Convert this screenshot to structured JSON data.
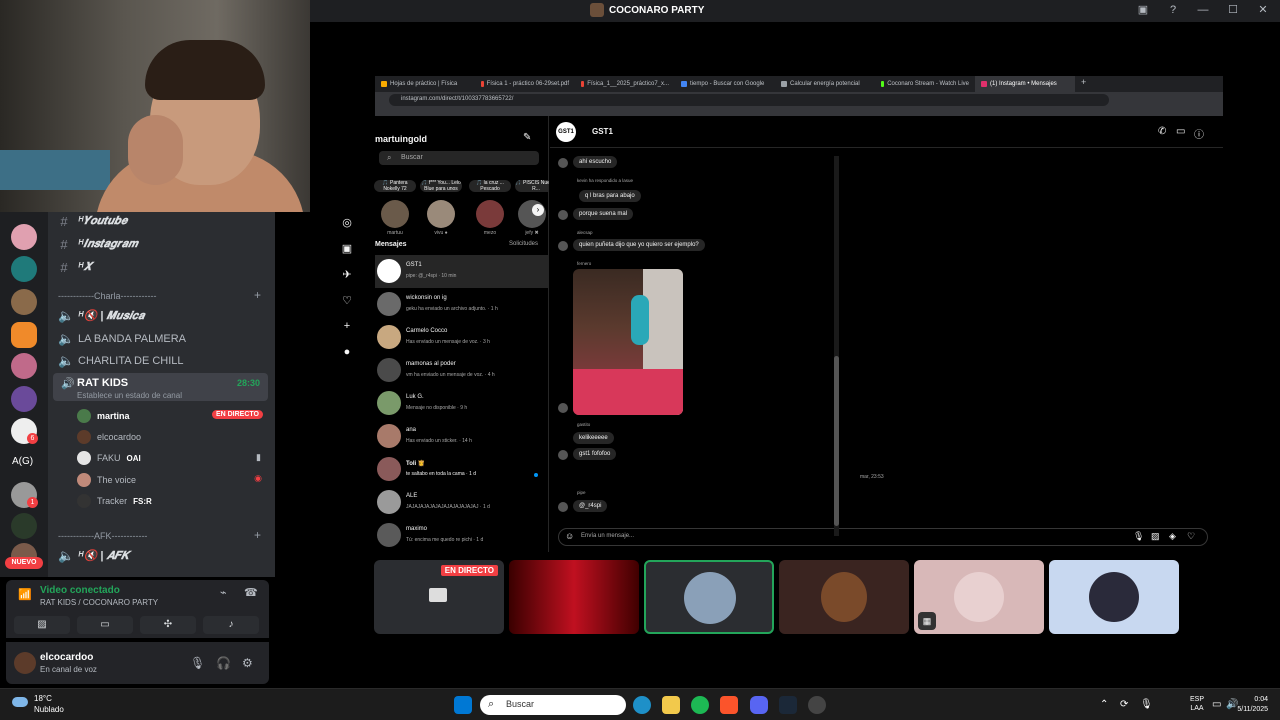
{
  "window": {
    "title": "COCONARO PARTY"
  },
  "channels": {
    "text": [
      {
        "icon": "#",
        "label": "ᴴ𝒀𝒐𝒖𝒕𝒖𝒃𝒆"
      },
      {
        "icon": "#",
        "label": "ᴴ𝑰𝒏𝒔𝒕𝒂𝒈𝒓𝒂𝒎"
      },
      {
        "icon": "#",
        "label": "ᴴ𝑿"
      }
    ],
    "category_charla": "------------Charla------------",
    "voice": [
      {
        "label": "ᴴ🔇 | 𝑴𝒖𝒔𝒊𝒄𝒂"
      },
      {
        "label": "LA BANDA PALMERA"
      },
      {
        "label": "CHARLITA DE CHILL"
      }
    ],
    "active": {
      "label": "RAT KIDS",
      "timer": "28:30",
      "status": "Establece un estado de canal"
    },
    "members": [
      {
        "name": "martina",
        "badge": "EN DIRECTO",
        "color": "#4a7a4a"
      },
      {
        "name": "elcocardoo",
        "badge": "",
        "color": "#5c3b2a"
      },
      {
        "name": "FAKU",
        "badge": "OAI",
        "color": "#e5e5e5"
      },
      {
        "name": "The voice",
        "badge": "",
        "color": "#c08a7a"
      },
      {
        "name": "Tracker",
        "badge": "FS:R",
        "color": "#333"
      }
    ],
    "category_afk": "------------AFK------------",
    "afk": {
      "label": "ᴴ🔇 | 𝑨𝑭𝑲"
    }
  },
  "servers": {
    "new_label": "NUEVO",
    "ag_label": "A(G)",
    "badges": [
      "6",
      "1"
    ]
  },
  "voice_panel": {
    "status": "Video conectado",
    "location": "RAT KIDS / COCONARO PARTY"
  },
  "user_panel": {
    "name": "elcocardoo",
    "status": "En canal de voz"
  },
  "browser": {
    "tabs": [
      "Hojas de práctico | Física",
      "Física 1 - práctico 06-29set.pdf",
      "Física_1__2025_práctico7_x...",
      "tiempo - Buscar con Google",
      "Calcular energía potencial",
      "Coconaro Stream - Watch Live",
      "(1) Instagram • Mensajes"
    ],
    "url": "instagram.com/direct/t/100337783665722/"
  },
  "instagram": {
    "account": "martuingold",
    "search_placeholder": "Buscar",
    "notes": [
      {
        "bubble": "🎵 Pantera Nokelly 72",
        "name": "martuu"
      },
      {
        "bubble": "🎵 f*** You... Lelo Blue para unos par...",
        "name": "vivu ●"
      },
      {
        "bubble": "🎵 la cruz ... Pescado",
        "name": "mezo"
      },
      {
        "bubble": "🎵 PISCIS Nueva, R...",
        "name": "jefy ✖"
      }
    ],
    "messages_label": "Mensajes",
    "requests_label": "Solicitudes",
    "conversations": [
      {
        "name": "GST1",
        "preview": "pipe: @_r4spi · 10 min"
      },
      {
        "name": "wickonsin on ig",
        "preview": "geku ha enviado un archivo adjunto. · 1 h"
      },
      {
        "name": "Carmelo Cocco",
        "preview": "Has enviado un mensaje de voz. · 3 h"
      },
      {
        "name": "mamonas al poder",
        "preview": "vm ha enviado un mensaje de voz. · 4 h"
      },
      {
        "name": "Luk G.",
        "preview": "Mensaje no disponible · 9 h"
      },
      {
        "name": "ana",
        "preview": "Has enviado un sticker. · 14 h"
      },
      {
        "name": "Toli 👸",
        "preview": "te saltabo en toda la cama · 1 d"
      },
      {
        "name": "ALE",
        "preview": "JAJAJAJAJAJAJAJAJAJAJAJAJ · 1 d"
      },
      {
        "name": "maximo",
        "preview": "Tú: encima me quedo re pichi · 1 d"
      }
    ],
    "chat": {
      "name": "GST1",
      "avatar_text": "GST1",
      "messages": [
        {
          "sender": "",
          "text": "ahí escucho"
        },
        {
          "sender": "kevin ha respondido a lasue",
          "text": "q l bras para abajo"
        },
        {
          "sender": "",
          "text": "porque suena mal"
        },
        {
          "sender": "alecsap",
          "text": "quien puñeta dijo que yo quiero ser ejemplo?"
        },
        {
          "sender": "fernero",
          "text": ""
        },
        {
          "sender": "gastito",
          "text": "kelikeeeee"
        },
        {
          "sender": "",
          "text": "gst1 fofofoo"
        },
        {
          "sender": "pipe",
          "text": "@_r4spi"
        }
      ],
      "timestamp": "mar, 23:53",
      "composer_placeholder": "Envía un mensaje..."
    }
  },
  "tiles": {
    "live_label": "EN DIRECTO"
  },
  "taskbar": {
    "weather_temp": "18°C",
    "weather_desc": "Nublado",
    "search_placeholder": "Buscar",
    "lang1": "ESP",
    "lang2": "LAA",
    "time": "0:04",
    "date": "5/11/2025"
  }
}
